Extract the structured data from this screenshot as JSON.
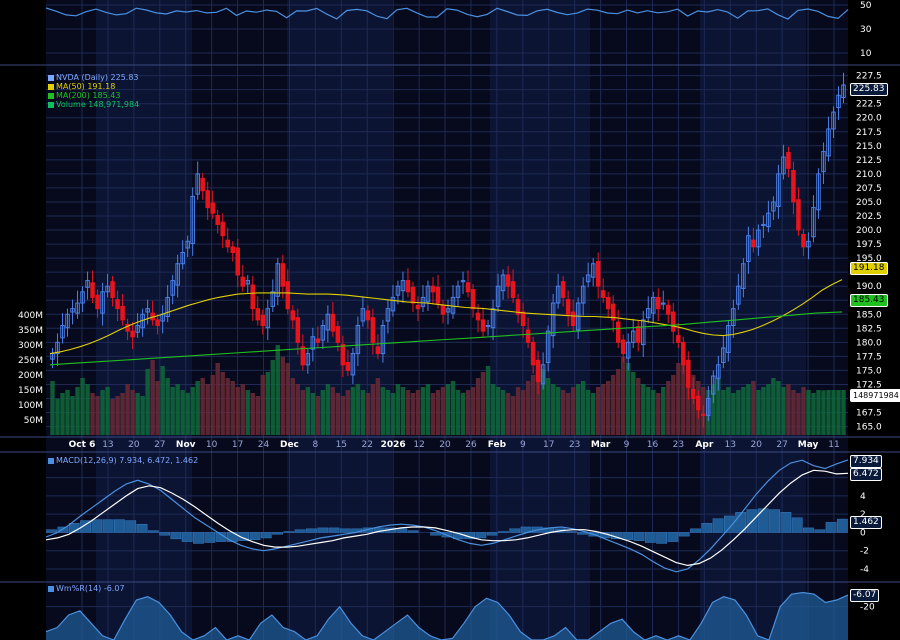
{
  "chart_data": [
    {
      "type": "line",
      "panel": "Williams %R upper strip",
      "y_ticks": [
        "50",
        "30",
        "10"
      ],
      "grid": true
    },
    {
      "type": "candlestick",
      "ticker": "NVDA",
      "legend": [
        {
          "label": "NVDA (Daily) 225.83",
          "color": "#7da7ff"
        },
        {
          "label": "MA(50) 191.18",
          "color": "#e0d000"
        },
        {
          "label": "MA(200) 185.43",
          "color": "#20c020"
        },
        {
          "label": "Volume 148,971,984",
          "color": "#10c060"
        }
      ],
      "x_tick_labels": [
        "Oct 6",
        "13",
        "20",
        "27",
        "Nov",
        "10",
        "17",
        "24",
        "Dec",
        "8",
        "15",
        "22",
        "2026",
        "12",
        "20",
        "26",
        "Feb",
        "9",
        "17",
        "23",
        "Mar",
        "9",
        "16",
        "23",
        "Apr",
        "13",
        "20",
        "27",
        "May",
        "11"
      ],
      "x_tick_bold": [
        "Oct 6",
        "Nov",
        "Dec",
        "2026",
        "Feb",
        "Mar",
        "Apr",
        "May"
      ],
      "y_ticks": [
        "227.5",
        "225.0",
        "222.5",
        "220.0",
        "217.5",
        "215.0",
        "212.5",
        "210.0",
        "207.5",
        "205.0",
        "202.5",
        "200.0",
        "197.5",
        "195.0",
        "192.5",
        "190.0",
        "187.5",
        "185.0",
        "182.5",
        "180.0",
        "177.5",
        "175.0",
        "172.5",
        "170.0",
        "167.5",
        "165.0"
      ],
      "ylim": [
        163.5,
        228.5
      ],
      "volume_ticks": [
        "400M",
        "350M",
        "300M",
        "250M",
        "200M",
        "150M",
        "100M",
        "50M"
      ],
      "volume_max": 450000000,
      "price_badges": [
        {
          "label": "225.83",
          "value": 225.83,
          "color": "#7da7ff"
        },
        {
          "label": "191.18",
          "value": 191.18,
          "color": "#e0d000"
        },
        {
          "label": "185.43",
          "value": 185.43,
          "color": "#20c020"
        }
      ],
      "volume_badge": {
        "label": "148971984",
        "value": 148971984
      },
      "closes": [
        178,
        180,
        183,
        185,
        186,
        187,
        189,
        191,
        188,
        186,
        189,
        190,
        188,
        186,
        184,
        182,
        181,
        183,
        185,
        186,
        184,
        183,
        185,
        188,
        191,
        194,
        196,
        198,
        206,
        210,
        207,
        204,
        203,
        201,
        199,
        197,
        196,
        192,
        190,
        191,
        186,
        184,
        183,
        186,
        189,
        194,
        190,
        186,
        184,
        180,
        176,
        178,
        181,
        180,
        183,
        185,
        182,
        180,
        176,
        175,
        178,
        183,
        186,
        184,
        180,
        178,
        183,
        186,
        188,
        190,
        191,
        189,
        187,
        186,
        188,
        190,
        189,
        187,
        185,
        186,
        188,
        190,
        191,
        189,
        186,
        184,
        182,
        183,
        186,
        190,
        192,
        190,
        188,
        185,
        183,
        180,
        176,
        173,
        176,
        182,
        187,
        190,
        188,
        185,
        183,
        187,
        190,
        192,
        194,
        190,
        188,
        186,
        184,
        180,
        178,
        180,
        182,
        180,
        184,
        186,
        188,
        186,
        187,
        185,
        182,
        180,
        176,
        172,
        170,
        168,
        167,
        170,
        174,
        176,
        179,
        183,
        186,
        190,
        194,
        199,
        197,
        200,
        201,
        203,
        205,
        210,
        213,
        211,
        205,
        200,
        197,
        198,
        204,
        210,
        214,
        218,
        221,
        224,
        225.83
      ],
      "ma50": [
        178,
        178.3,
        178.7,
        179.2,
        179.8,
        180.5,
        181.3,
        182.2,
        183,
        183.7,
        184.3,
        184.8,
        185.4,
        186,
        186.6,
        187.1,
        187.6,
        188,
        188.3,
        188.6,
        188.7,
        188.8,
        188.8,
        188.8,
        188.8,
        188.7,
        188.6,
        188.6,
        188.6,
        188.5,
        188.4,
        188.2,
        188,
        187.8,
        187.6,
        187.4,
        187.2,
        187.1,
        187,
        186.8,
        186.6,
        186.4,
        186.2,
        186.1,
        186,
        185.8,
        185.6,
        185.4,
        185.2,
        185.1,
        185,
        184.9,
        184.8,
        184.7,
        184.6,
        184.6,
        184.5,
        184.4,
        184.2,
        184,
        183.8,
        183.5,
        183.2,
        182.9,
        182.5,
        182,
        181.6,
        181.3,
        181.2,
        181.4,
        181.8,
        182.3,
        183,
        183.8,
        184.7,
        185.7,
        186.8,
        188,
        189.3,
        190.3,
        191.18
      ],
      "ma200": [
        176,
        176.3,
        176.6,
        176.9,
        177.2,
        177.5,
        177.8,
        178.1,
        178.4,
        178.7,
        179,
        179.3,
        179.6,
        179.9,
        180.2,
        180.5,
        180.8,
        181.1,
        181.4,
        181.7,
        182,
        182.3,
        182.6,
        182.9,
        183.2,
        183.6,
        184,
        184.4,
        184.8,
        185.2,
        185.43
      ],
      "volumes_m": [
        180,
        120,
        140,
        150,
        130,
        160,
        190,
        170,
        140,
        130,
        150,
        160,
        120,
        130,
        140,
        170,
        150,
        140,
        130,
        220,
        250,
        180,
        230,
        190,
        160,
        170,
        150,
        140,
        160,
        180,
        190,
        170,
        200,
        240,
        210,
        190,
        180,
        160,
        170,
        150,
        140,
        130,
        200,
        210,
        250,
        300,
        260,
        240,
        190,
        170,
        150,
        160,
        140,
        130,
        150,
        170,
        160,
        140,
        130,
        150,
        160,
        170,
        150,
        140,
        170,
        190,
        160,
        150,
        140,
        170,
        160,
        150,
        140,
        150,
        160,
        170,
        140,
        150,
        160,
        170,
        180,
        150,
        140,
        150,
        160,
        190,
        210,
        230,
        170,
        160,
        150,
        140,
        130,
        160,
        150,
        180,
        200,
        240,
        220,
        190,
        170,
        160,
        150,
        140,
        160,
        170,
        180,
        150,
        140,
        160,
        170,
        180,
        200,
        220,
        260,
        240,
        210,
        190,
        170,
        160,
        150,
        140,
        160,
        180,
        200,
        240,
        260,
        220,
        200,
        180,
        160,
        150,
        170,
        190,
        150,
        160,
        140,
        150,
        160,
        170,
        180,
        150,
        160,
        170,
        190,
        180,
        160,
        170,
        150,
        140,
        160,
        150,
        140,
        150,
        149
      ]
    },
    {
      "type": "line",
      "panel": "MACD",
      "legend": [
        {
          "label": "MACD(12,26,9) 7.934, 6.472, 1.462",
          "color": "#4a90e0"
        }
      ],
      "y_ticks": [
        "6",
        "4",
        "2",
        "0",
        "-2",
        "-4"
      ],
      "ylim": [
        -5.2,
        8.8
      ],
      "badges": [
        {
          "label": "7.934",
          "value": 7.934,
          "color": "#7da7ff"
        },
        {
          "label": "6.472",
          "value": 6.472,
          "color": "#ffffff"
        },
        {
          "label": "1.462",
          "value": 1.462,
          "color": "#7da7ff"
        }
      ],
      "macd": [
        -0.5,
        0,
        0.8,
        1.8,
        2.7,
        3.6,
        4.5,
        5.3,
        5.7,
        5.3,
        4.6,
        3.6,
        2.6,
        1.6,
        0.8,
        0,
        -0.8,
        -1.4,
        -1.8,
        -2,
        -1.8,
        -1.5,
        -1.2,
        -0.9,
        -0.6,
        -0.4,
        -0.2,
        0,
        0.3,
        0.6,
        0.8,
        0.9,
        0.8,
        0.6,
        0.2,
        -0.3,
        -0.8,
        -1.2,
        -1.4,
        -1.2,
        -0.8,
        -0.4,
        0,
        0.3,
        0.5,
        0.6,
        0.4,
        0.1,
        -0.3,
        -0.8,
        -1.3,
        -1.8,
        -2.4,
        -3.2,
        -3.9,
        -4.3,
        -4,
        -3,
        -1.8,
        -0.4,
        1,
        2.6,
        4.2,
        5.6,
        6.8,
        7.6,
        7.9,
        7.3,
        7,
        7.5,
        7.934
      ],
      "signal": [
        -0.8,
        -0.6,
        -0.2,
        0.5,
        1.3,
        2.2,
        3.1,
        4,
        4.8,
        5.1,
        4.9,
        4.3,
        3.6,
        2.8,
        1.9,
        1,
        0.2,
        -0.5,
        -1,
        -1.4,
        -1.6,
        -1.6,
        -1.5,
        -1.3,
        -1.1,
        -0.9,
        -0.6,
        -0.4,
        -0.2,
        0.1,
        0.3,
        0.5,
        0.6,
        0.6,
        0.5,
        0.2,
        -0.1,
        -0.5,
        -0.8,
        -0.9,
        -0.9,
        -0.8,
        -0.6,
        -0.3,
        0,
        0.2,
        0.3,
        0.3,
        0.1,
        -0.2,
        -0.6,
        -1,
        -1.5,
        -2.1,
        -2.7,
        -3.3,
        -3.6,
        -3.4,
        -2.8,
        -1.9,
        -0.8,
        0.4,
        1.7,
        3,
        4.3,
        5.4,
        6.3,
        6.8,
        6.7,
        6.4,
        6.472
      ],
      "histogram": [
        0.3,
        0.6,
        1,
        1.3,
        1.4,
        1.4,
        1.4,
        1.3,
        0.9,
        0.2,
        -0.3,
        -0.7,
        -1,
        -1.2,
        -1.1,
        -1,
        -1,
        -0.9,
        -0.8,
        -0.6,
        -0.2,
        0.1,
        0.3,
        0.4,
        0.5,
        0.5,
        0.4,
        0.4,
        0.5,
        0.5,
        0.5,
        0.4,
        0.2,
        0,
        -0.3,
        -0.5,
        -0.7,
        -0.7,
        -0.6,
        -0.3,
        0.1,
        0.4,
        0.6,
        0.6,
        0.5,
        0.4,
        0.1,
        -0.2,
        -0.4,
        -0.6,
        -0.7,
        -0.8,
        -0.9,
        -1.1,
        -1.2,
        -1,
        -0.4,
        0.4,
        1,
        1.5,
        1.8,
        2.2,
        2.5,
        2.6,
        2.5,
        2.2,
        1.6,
        0.5,
        0.3,
        1.1,
        1.462
      ]
    },
    {
      "type": "area",
      "panel": "Williams %R",
      "legend": [
        {
          "label": "Wm%R(14) -6.07",
          "color": "#4a90e0"
        }
      ],
      "y_ticks": [
        "-20"
      ],
      "ylim": [
        -60,
        0
      ],
      "badge": {
        "label": "-6.07",
        "value": -6.07
      },
      "values": [
        -50,
        -45,
        -30,
        -25,
        -40,
        -55,
        -60,
        -35,
        -12,
        -8,
        -15,
        -30,
        -50,
        -60,
        -55,
        -45,
        -60,
        -55,
        -60,
        -40,
        -30,
        -45,
        -50,
        -60,
        -55,
        -35,
        -20,
        -40,
        -55,
        -60,
        -50,
        -40,
        -30,
        -45,
        -55,
        -60,
        -58,
        -40,
        -20,
        -10,
        -15,
        -30,
        -50,
        -60,
        -60,
        -55,
        -45,
        -60,
        -60,
        -50,
        -40,
        -35,
        -50,
        -60,
        -55,
        -60,
        -55,
        -60,
        -40,
        -15,
        -8,
        -12,
        -30,
        -55,
        -60,
        -20,
        -5,
        -3,
        -5,
        -15,
        -12,
        -6.07
      ]
    }
  ]
}
